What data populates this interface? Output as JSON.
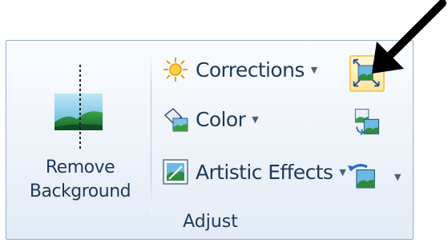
{
  "group": {
    "label": "Adjust"
  },
  "remove_background": {
    "label_line1": "Remove",
    "label_line2": "Background",
    "icon": "remove-background-icon"
  },
  "commands": {
    "corrections": {
      "label": "Corrections",
      "icon": "corrections-sun-icon",
      "has_dropdown": true
    },
    "color": {
      "label": "Color",
      "icon": "color-bucket-icon",
      "has_dropdown": true
    },
    "artistic_effects": {
      "label": "Artistic Effects",
      "icon": "artistic-effects-icon",
      "has_dropdown": true
    }
  },
  "small_buttons": {
    "compress_pictures": {
      "icon": "compress-pictures-icon",
      "highlighted": true
    },
    "change_picture": {
      "icon": "change-picture-icon"
    },
    "reset_picture": {
      "icon": "reset-picture-icon",
      "has_dropdown": true
    }
  },
  "annotation": {
    "icon": "black-arrow-pointer-icon"
  },
  "colors": {
    "text": "#1e395b",
    "group_border": "#98acc7",
    "highlight_border": "#f2c96a",
    "highlight_fill": "#ffe59a",
    "arrow": "#000000"
  }
}
